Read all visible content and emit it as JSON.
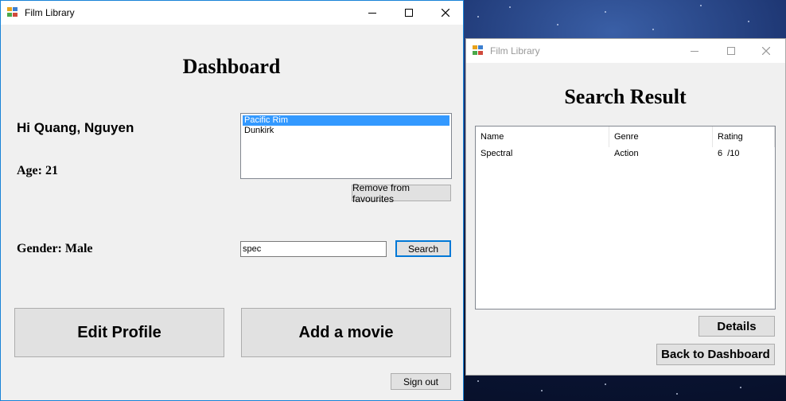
{
  "dashboard_window": {
    "title": "Film Library",
    "heading": "Dashboard",
    "greeting": "Hi Quang, Nguyen",
    "age": "Age: 21",
    "gender": "Gender: Male",
    "favourites": [
      "Pacific Rim",
      "Dunkirk"
    ],
    "remove_button": "Remove from favourites",
    "search_value": "spec",
    "search_button": "Search",
    "edit_profile_button": "Edit Profile",
    "add_movie_button": "Add a movie",
    "sign_out_button": "Sign out"
  },
  "search_window": {
    "title": "Film Library",
    "heading": "Search Result",
    "columns": [
      "Name",
      "Genre",
      "Rating"
    ],
    "rows": [
      {
        "name": "Spectral",
        "genre": "Action",
        "rating": "6  /10"
      }
    ],
    "details_button": "Details",
    "back_button": "Back to Dashboard"
  },
  "icons": {
    "app": "film-library-app-icon",
    "minimize": "minimize-icon",
    "maximize": "maximize-icon",
    "close": "close-icon"
  },
  "colors": {
    "active_border": "#1883d7",
    "selection": "#3399ff",
    "focus_border": "#0078d7"
  }
}
